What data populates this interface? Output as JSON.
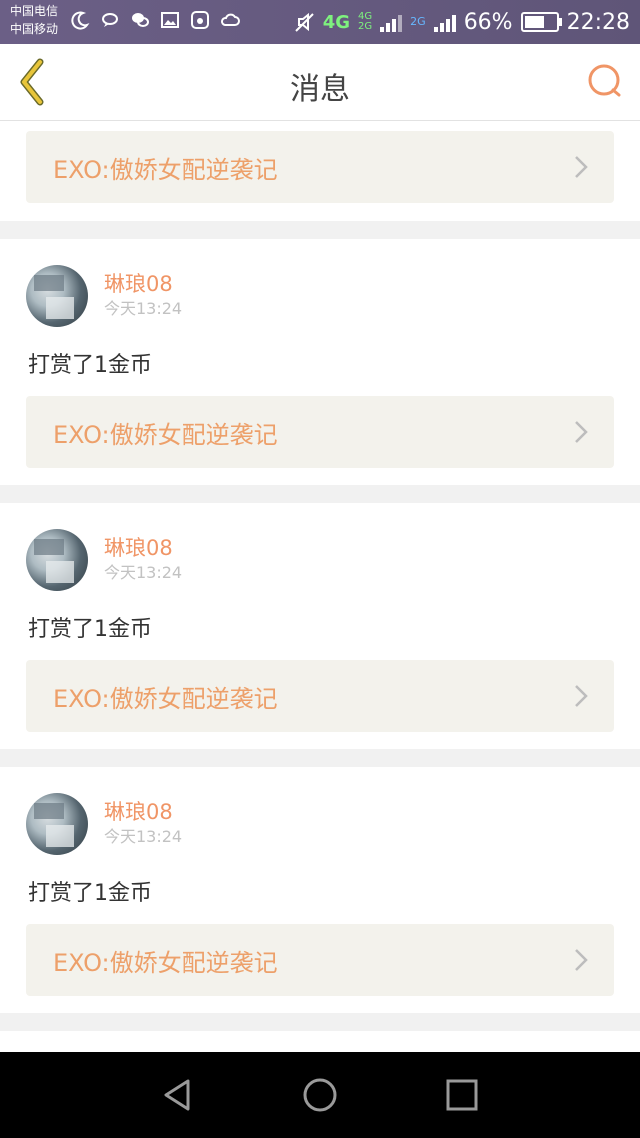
{
  "status_bar": {
    "carrier_1": "中国电信",
    "carrier_2": "中国移动",
    "net_4g": "4G",
    "net_4g_small": "4G",
    "net_2g_small": "2G",
    "net_2g": "2G",
    "battery_pct": "66%",
    "time": "22:28",
    "battery_level": 0.66
  },
  "header": {
    "title": "消息",
    "back_icon": "chevron-left-icon",
    "search_icon": "search-icon"
  },
  "top_item": {
    "book_title": "EXO:傲娇女配逆袭记"
  },
  "messages": [
    {
      "username": "琳琅08",
      "time": "今天13:24",
      "text": "打赏了1金币",
      "book_title": "EXO:傲娇女配逆袭记"
    },
    {
      "username": "琳琅08",
      "time": "今天13:24",
      "text": "打赏了1金币",
      "book_title": "EXO:傲娇女配逆袭记"
    },
    {
      "username": "琳琅08",
      "time": "今天13:24",
      "text": "打赏了1金币",
      "book_title": "EXO:傲娇女配逆袭记"
    }
  ],
  "colors": {
    "accent_orange": "#f09566",
    "book_bg": "#f3f2ec",
    "back_yellow": "#e8c53a"
  },
  "nav": {
    "back": "triangle-back-icon",
    "home": "circle-home-icon",
    "recent": "square-recent-icon"
  }
}
